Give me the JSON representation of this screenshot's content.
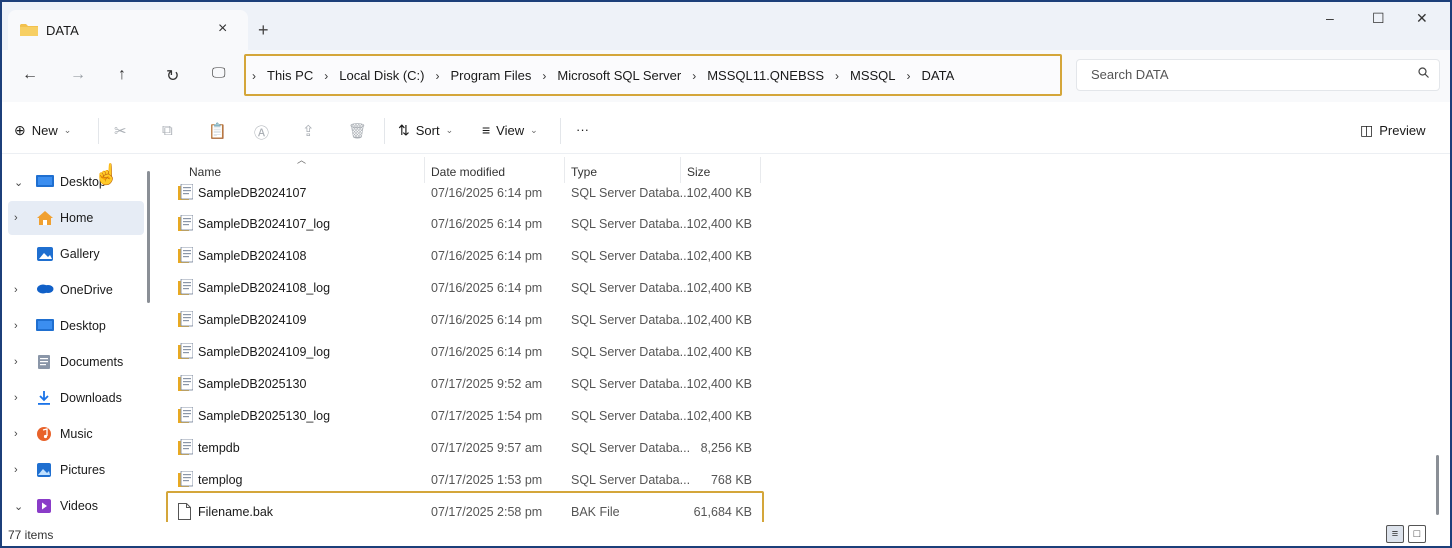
{
  "tab": {
    "title": "DATA",
    "close": "×",
    "new_tab": "+"
  },
  "window_controls": {
    "minimize": "–",
    "maximize": "☐",
    "close": "✕"
  },
  "nav": {
    "back": "←",
    "forward": "→",
    "up": "↑",
    "refresh": "↻",
    "computer": "🖵",
    "expand": "›"
  },
  "breadcrumbs": [
    "This PC",
    "Local Disk (C:)",
    "Program Files",
    "Microsoft SQL Server",
    "MSSQL11.QNEBSS",
    "MSSQL",
    "DATA"
  ],
  "breadcrumb_separator": "›",
  "search": {
    "placeholder": "Search DATA"
  },
  "commandbar": {
    "new": "New",
    "sort": "Sort",
    "view": "View",
    "more": "···",
    "preview": "Preview"
  },
  "sidebar": {
    "items": [
      {
        "label": "Desktop",
        "icon": "desktop-icon",
        "chev": "⌄"
      },
      {
        "label": "Home",
        "icon": "home-icon",
        "chev": "›"
      },
      {
        "label": "Gallery",
        "icon": "gallery-icon",
        "chev": ""
      },
      {
        "label": "OneDrive",
        "icon": "cloud-icon",
        "chev": "›"
      },
      {
        "label": "Desktop",
        "icon": "desktop-icon",
        "chev": "›"
      },
      {
        "label": "Documents",
        "icon": "documents-icon",
        "chev": "›"
      },
      {
        "label": "Downloads",
        "icon": "downloads-icon",
        "chev": "›"
      },
      {
        "label": "Music",
        "icon": "music-icon",
        "chev": "›"
      },
      {
        "label": "Pictures",
        "icon": "pictures-icon",
        "chev": "›"
      },
      {
        "label": "Videos",
        "icon": "videos-icon",
        "chev": "⌄"
      }
    ]
  },
  "columns": {
    "name": "Name",
    "date": "Date modified",
    "type": "Type",
    "size": "Size"
  },
  "files": [
    {
      "name": "SampleDB2024107",
      "date": "07/16/2025 6:14 pm",
      "type": "SQL Server Databa...",
      "size": "102,400 KB"
    },
    {
      "name": "SampleDB2024107_log",
      "date": "07/16/2025 6:14 pm",
      "type": "SQL Server Databa...",
      "size": "102,400 KB"
    },
    {
      "name": "SampleDB2024108",
      "date": "07/16/2025 6:14 pm",
      "type": "SQL Server Databa...",
      "size": "102,400 KB"
    },
    {
      "name": "SampleDB2024108_log",
      "date": "07/16/2025 6:14 pm",
      "type": "SQL Server Databa...",
      "size": "102,400 KB"
    },
    {
      "name": "SampleDB2024109",
      "date": "07/16/2025 6:14 pm",
      "type": "SQL Server Databa...",
      "size": "102,400 KB"
    },
    {
      "name": "SampleDB2024109_log",
      "date": "07/16/2025 6:14 pm",
      "type": "SQL Server Databa...",
      "size": "102,400 KB"
    },
    {
      "name": "SampleDB2025130",
      "date": "07/17/2025 9:52 am",
      "type": "SQL Server Databa...",
      "size": "102,400 KB"
    },
    {
      "name": "SampleDB2025130_log",
      "date": "07/17/2025 1:54 pm",
      "type": "SQL Server Databa...",
      "size": "102,400 KB"
    },
    {
      "name": "tempdb",
      "date": "07/17/2025 9:57 am",
      "type": "SQL Server Databa...",
      "size": "8,256 KB"
    },
    {
      "name": "templog",
      "date": "07/17/2025 1:53 pm",
      "type": "SQL Server Databa...",
      "size": "768 KB"
    },
    {
      "name": "Filename.bak",
      "date": "07/17/2025 2:58 pm",
      "type": "BAK File",
      "size": "61,684 KB"
    }
  ],
  "status": {
    "count": "77 items"
  },
  "colors": {
    "highlight": "#d4a63a",
    "frame": "#1c3f7a",
    "folder": "#f2c14e"
  }
}
